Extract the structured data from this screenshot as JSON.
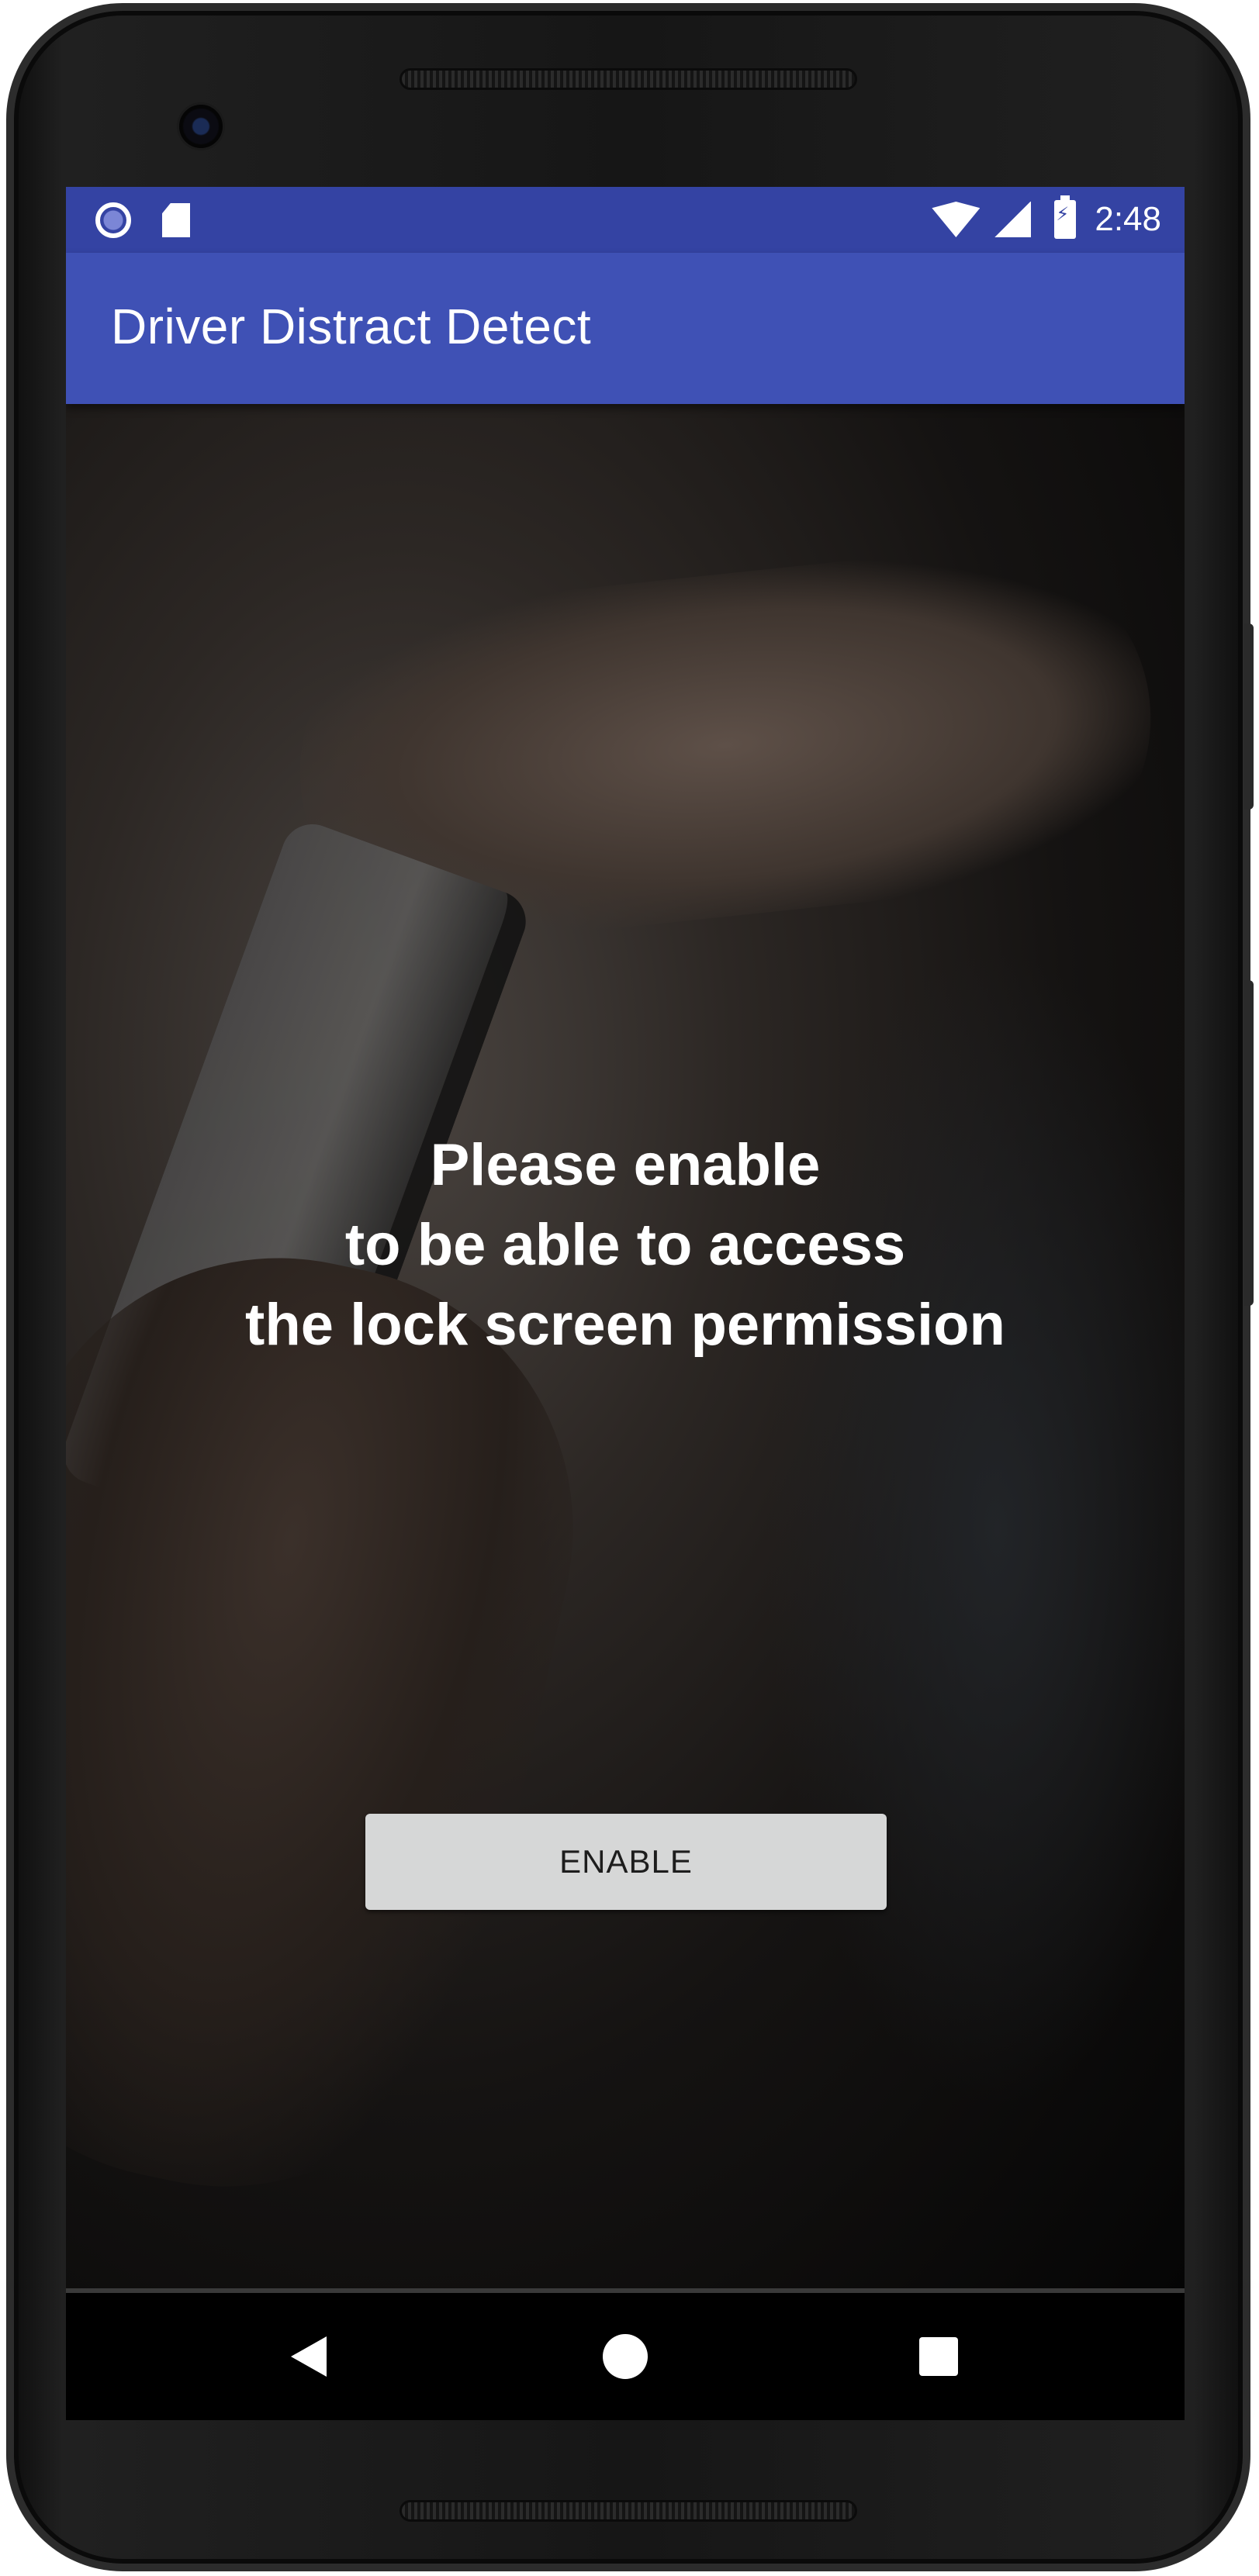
{
  "status_bar": {
    "time": "2:48",
    "icons": [
      "sync-icon",
      "sd-card-icon",
      "wifi-icon",
      "cell-signal-icon",
      "battery-charging-icon"
    ],
    "background_color": "#3443a3"
  },
  "app_bar": {
    "title": "Driver Distract Detect",
    "background_color": "#3f51b5"
  },
  "main": {
    "message": "Please enable\nto be able to access\nthe lock screen permission",
    "enable_button_label": "ENABLE"
  },
  "nav_bar": {
    "icons": [
      "back-icon",
      "home-icon",
      "recents-icon"
    ]
  }
}
